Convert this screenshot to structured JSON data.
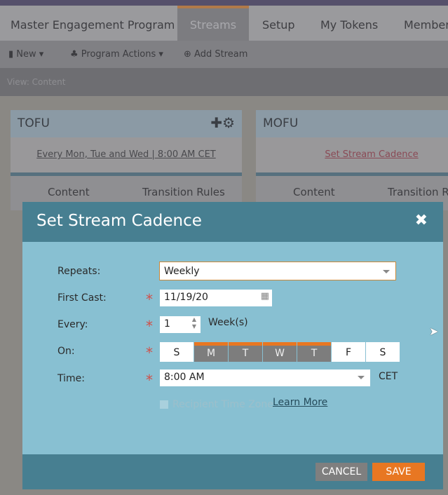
{
  "tabs": [
    "Master Engagement Program",
    "Streams",
    "Setup",
    "My Tokens",
    "Member"
  ],
  "toolbar": {
    "new": "New",
    "program_actions": "Program Actions",
    "add_stream": "Add Stream"
  },
  "view": "View: Content",
  "panels": [
    {
      "title": "TOFU",
      "cadence": "Every Mon, Tue and Wed | 8:00 AM CET",
      "tabs": [
        "Content",
        "Transition Rules"
      ]
    },
    {
      "title": "MOFU",
      "cadence": "Set Stream Cadence",
      "tabs": [
        "Content",
        "Transition R"
      ]
    }
  ],
  "modal": {
    "title": "Set Stream Cadence",
    "repeats_label": "Repeats:",
    "repeats_value": "Weekly",
    "first_cast_label": "First Cast:",
    "first_cast_value": "11/19/20",
    "every_label": "Every:",
    "every_value": "1",
    "every_unit": "Week(s)",
    "on_label": "On:",
    "days": [
      {
        "d": "S",
        "on": false
      },
      {
        "d": "M",
        "on": true
      },
      {
        "d": "T",
        "on": true
      },
      {
        "d": "W",
        "on": true
      },
      {
        "d": "T",
        "on": true
      },
      {
        "d": "F",
        "on": false
      },
      {
        "d": "S",
        "on": false
      }
    ],
    "time_label": "Time:",
    "time_value": "8:00 AM",
    "timezone": "CET",
    "recipient_tz": "Recipient Time Zone",
    "learn_more": "Learn More",
    "cancel": "CANCEL",
    "save": "SAVE"
  },
  "colors": {
    "accent": "#e87722",
    "header": "#477f91",
    "body": "#88c0d2"
  }
}
